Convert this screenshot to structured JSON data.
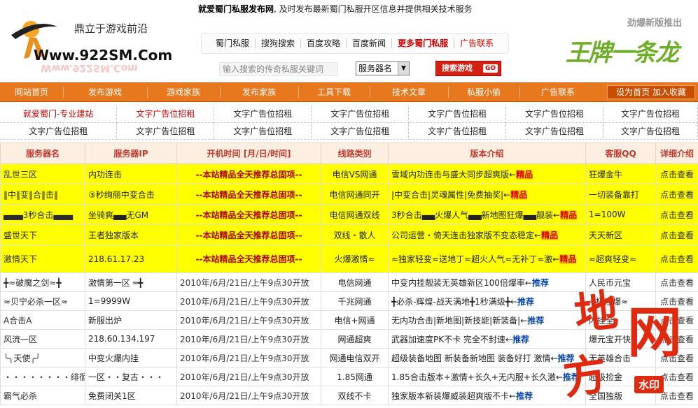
{
  "header": {
    "top_tag_bold": "就爱蜀门私服发布网",
    "top_tag_rest": ", 及时发布最新蜀门私服开区信息并提供相关技术服务",
    "logo_slogan": "鼎立于游戏前沿",
    "logo_url": "Www.922SM.Com",
    "nav": [
      "蜀门私服",
      "搜狗搜索",
      "百度攻略",
      "百度新闻",
      "更多蜀门私服",
      "广告联系"
    ],
    "search_placeholder": "输入搜索的传奇私服关键词",
    "search_select": "服务器名",
    "search_button": "搜索游戏",
    "search_go": "GO",
    "promo_title": "劲爆新版推出",
    "promo_text": "王牌一条龙"
  },
  "mainnav": {
    "items": [
      "网站首页",
      "发布游戏",
      "游戏家族",
      "发布家族",
      "工具下载",
      "技术文章",
      "私服小偷",
      "广告联系"
    ],
    "right": "设为首页  加入收藏"
  },
  "ads": {
    "row1": [
      "就爱蜀门-专业建站",
      "文字广告位招租",
      "文字广告位招租",
      "文字广告位招租",
      "文字广告位招租",
      "文字广告位招租",
      "文字广告位招租"
    ],
    "row2": [
      "文字广告位招租",
      "文字广告位招租",
      "文字广告位招租",
      "文字广告位招租",
      "文字广告位招租",
      "文字广告位招租",
      "文字广告位招租"
    ]
  },
  "table": {
    "headers": [
      "服务器名",
      "服务器IP",
      "开机时间 [月/日/时间]",
      "线路类别",
      "版本介绍",
      "客服QQ",
      "详细介绍"
    ],
    "hot_rows": [
      {
        "name": "乱世三区",
        "ip": "内功连击",
        "time": "--本站精品全天推荐总固项--",
        "line": "电信VS网通",
        "intro": "雪域内功连击与盛大同步超爽版←",
        "tag": "精品",
        "qq": "狂爆金牛",
        "detail": "点击查看"
      },
      {
        "name": "‖中‖变‖合‖击‖",
        "ip": "③秒绚丽中变合击",
        "time": "--本站精品全天推荐总固项--",
        "line": "电信网通同开",
        "intro": "|中变合击|灵魂属性|免费抽奖|←",
        "tag": "精品",
        "qq": "一切装备靠打",
        "detail": "点击查看"
      },
      {
        "name": "▄▄▄3秒合击▄▄▄",
        "ip": "坐骑爽▄▄无GM",
        "time": "--本站精品全天推荐总固项--",
        "line": "电信网通双线",
        "intro": "3秒合击▄▄火爆人气▄▄新地图狂爆▄▄靓装←",
        "tag": "精品",
        "qq": "1=100W",
        "detail": "点击查看"
      },
      {
        "name": "盛世天下",
        "ip": "王者独家版本",
        "time": "--本站精品全天推荐总固项--",
        "line": "双线・散人",
        "intro": "公司运营・倚天连击独家版不变态稳定←",
        "tag": "精品",
        "qq": "天天新区",
        "detail": "点击查看"
      },
      {
        "name": "激情天下",
        "ip": "218.61.17.23",
        "time": "--本站精品全天推荐总固项--",
        "line": "火爆激情≈",
        "intro": "≈独家轻变≈送地丁≈超火人气≈无补丁≈激←",
        "tag": "精品",
        "qq": "≈超爽轻变≈",
        "detail": "点击查看"
      }
    ],
    "rows": [
      {
        "name": "╋≈破魔之剑≈╋",
        "ip": "激情第一区  ═╋",
        "time": "2010年/6月/21日/上午9点30开放",
        "line": "电信网通",
        "intro": "中变内挂靓装无英雄新区100倍爆率←",
        "tag": "推荐",
        "qq": "人民币元宝",
        "detail": "点击查看"
      },
      {
        "name": "≈贝宁必杀一区≈",
        "ip": "1=9999W",
        "time": "2010年/6月/21日/上午9点30开放",
        "line": "千兆网通",
        "intro": "╋必杀-辉煌-战天满地╋1秒满级╋←",
        "tag": "推荐",
        "qq": "≈极怪爆≈",
        "detail": "点击查看"
      },
      {
        "name": "A合击A",
        "ip": "新服出炉",
        "time": "2010年/6月/21日/上午9点30开放",
        "line": "电信+网通",
        "intro": "无内功合击|新地图|新技能|新装备|←",
        "tag": "推荐",
        "qq": "内挂全",
        "detail": "点击查看"
      },
      {
        "name": "风流一区",
        "ip": "218.60.134.197",
        "time": "2010年/6月/21日/上午9点30开放",
        "line": "网通超爽",
        "intro": "武器加速度PK不卡 完全不封速←",
        "tag": "推荐",
        "qq": "爆元宝开快",
        "detail": "点击查看"
      },
      {
        "name": "╰╮天使╭╯",
        "ip": "中变火爆内挂",
        "time": "2010年/6月/21日/上午9点30开放",
        "line": "网通电信双开",
        "intro": "超级装备地图 新装备新地图 装备好打 激情←",
        "tag": "推荐",
        "qq": "无英雄合击",
        "detail": "点击查看"
      },
      {
        "name": "・・・・・・・・绯徊",
        "ip": "一区・・复古・・・",
        "time": "2010年/6月/21日/上午9点30开放",
        "line": "1.85网通",
        "intro": "1.85合击版本+激情+长久+无内服+长久激←",
        "tag": "推荐",
        "qq": "超级捡金",
        "detail": "点击查看"
      },
      {
        "name": "霸气必杀",
        "ip": "免费闭关1区",
        "time": "2010年/6月/21日/上午9点30开放",
        "line": "双线不卡",
        "intro": "独家版本新装爆威装超爽版不卡←",
        "tag": "推荐",
        "qq": "全国独版",
        "detail": "点击查看"
      }
    ]
  },
  "watermark": {
    "c1": "地",
    "c2": "网",
    "c3": "方",
    "badge": "水印"
  },
  "colors": {
    "nav": "#e8781e",
    "hot_row": "#ffff00",
    "header_row": "#fdeee2",
    "accent_red": "#d40000"
  }
}
